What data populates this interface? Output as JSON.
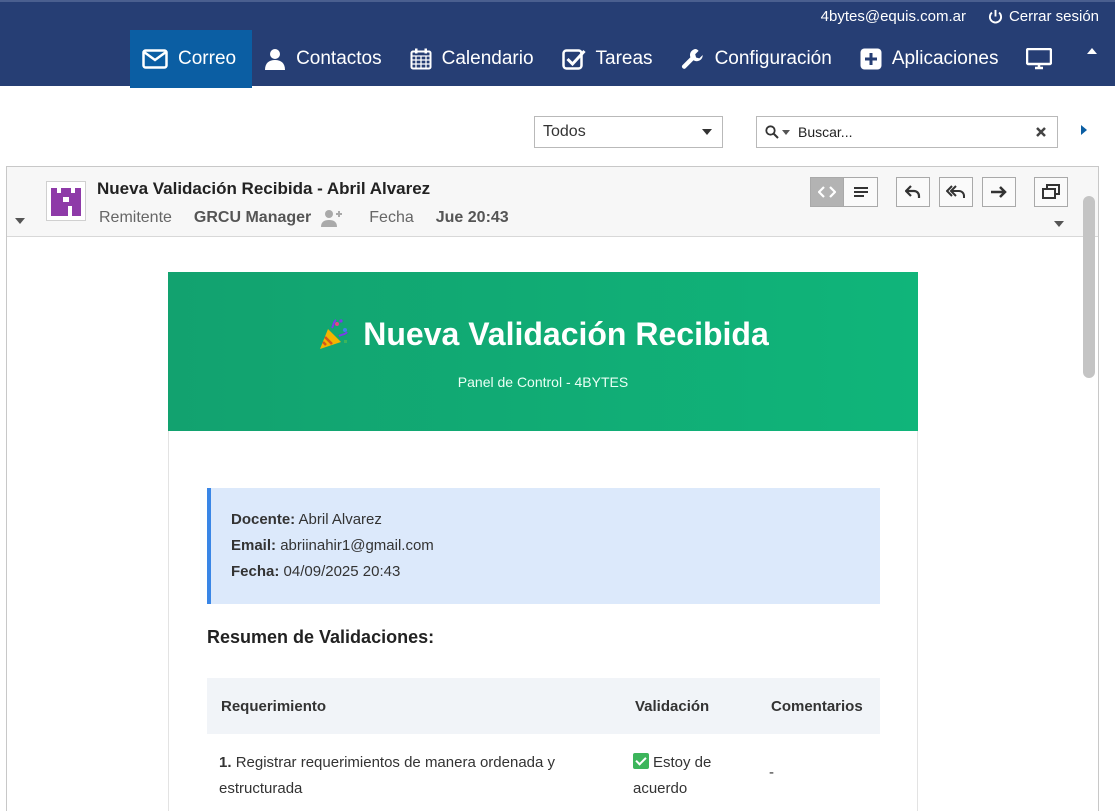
{
  "header": {
    "user_email": "4bytes@equis.com.ar",
    "logout_label": "Cerrar sesión",
    "nav": [
      {
        "label": "Correo",
        "icon": "envelope-icon",
        "active": true
      },
      {
        "label": "Contactos",
        "icon": "person-icon"
      },
      {
        "label": "Calendario",
        "icon": "calendar-icon"
      },
      {
        "label": "Tareas",
        "icon": "checkbox-icon"
      },
      {
        "label": "Configuración",
        "icon": "wrench-icon"
      },
      {
        "label": "Aplicaciones",
        "icon": "plus-square-icon"
      }
    ]
  },
  "toolbar": {
    "filter_value": "Todos",
    "search_placeholder": "Buscar..."
  },
  "message": {
    "subject": "Nueva Validación Recibida - Abril Alvarez",
    "from_label": "Remitente",
    "from_value": "GRCU Manager",
    "date_label": "Fecha",
    "date_value": "Jue 20:43"
  },
  "email": {
    "banner_title": "Nueva Validación Recibida",
    "banner_subtitle": "Panel de Control - 4BYTES",
    "info": {
      "docente_label": "Docente:",
      "docente_value": "Abril Alvarez",
      "email_label": "Email:",
      "email_value": "abriinahir1@gmail.com",
      "fecha_label": "Fecha:",
      "fecha_value": "04/09/2025 20:43"
    },
    "section_title": "Resumen de Validaciones:",
    "table": {
      "headers": [
        "Requerimiento",
        "Validación",
        "Comentarios"
      ],
      "rows": [
        {
          "num": "1.",
          "req": "Registrar requerimientos de manera ordenada y estructurada",
          "validation": "Estoy de acuerdo",
          "comment": "-"
        }
      ]
    }
  },
  "colors": {
    "topbar": "#263e74",
    "nav_active": "#0b5ea3",
    "banner": "#12a26f",
    "info_box": "#dce9fb",
    "info_border": "#3a86e6"
  }
}
